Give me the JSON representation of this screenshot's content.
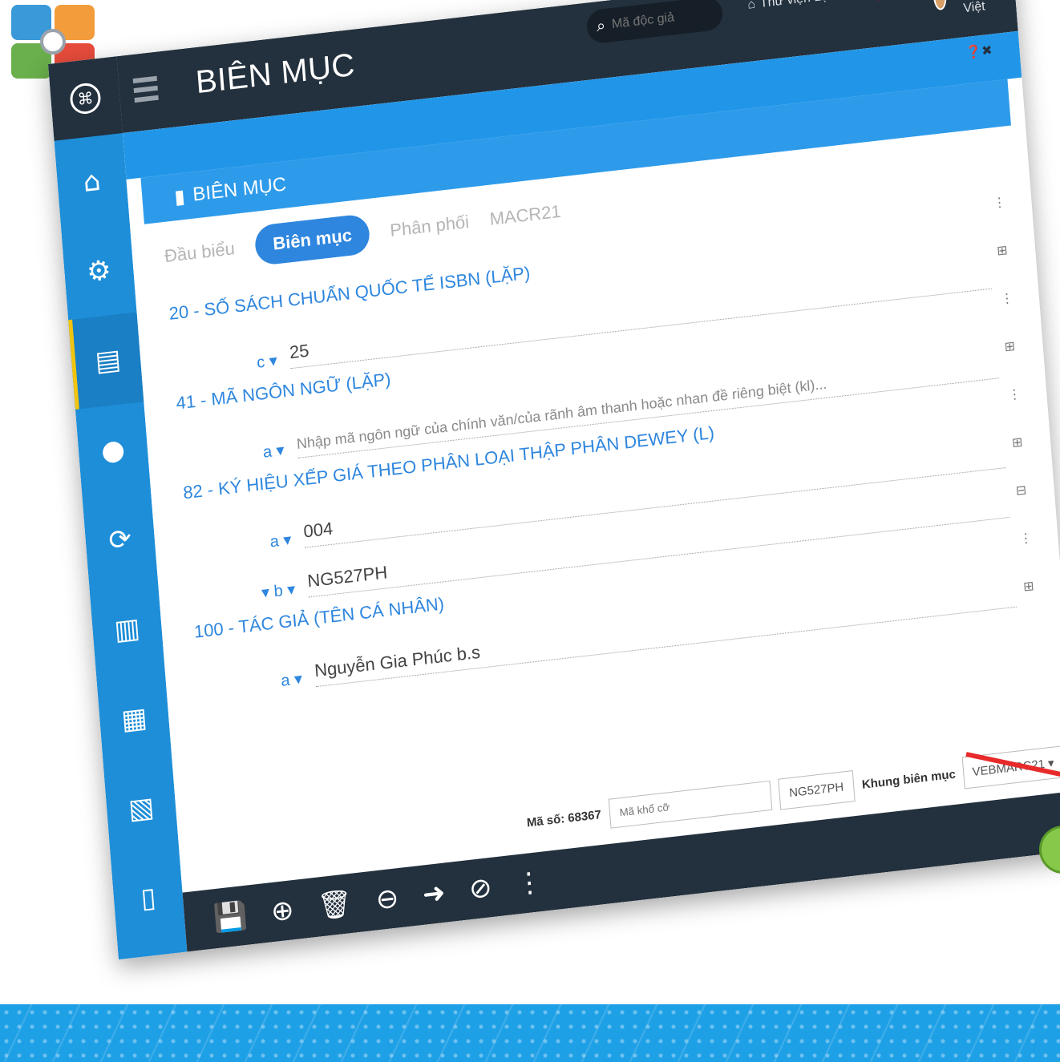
{
  "app": {
    "page_title": "BIÊN MỤC",
    "panel_title": "BIÊN MỤC"
  },
  "topbar": {
    "search_placeholder": "Mã độc giả",
    "library": "Thư viện Lạc V...",
    "user": "Quản trị viên Lạc Việt",
    "language_flag": "★"
  },
  "tabs": [
    "Đầu biểu",
    "Biên mục",
    "Phân phối",
    "MACR21"
  ],
  "fields": [
    {
      "title": "20 - SỐ SÁCH CHUẨN QUỐC TẾ ISBN (LẶP)",
      "rows": [
        {
          "code": "c",
          "value": "25",
          "placeholder": false
        }
      ]
    },
    {
      "title": "41 - MÃ NGÔN NGỮ (LẶP)",
      "rows": [
        {
          "code": "a",
          "value": "Nhập mã ngôn ngữ của chính văn/của rãnh âm thanh hoặc nhan đề riêng biệt (kl)...",
          "placeholder": true
        }
      ]
    },
    {
      "title": "82 - KÝ HIỆU XẾP GIÁ THEO PHÂN LOẠI THẬP PHÂN DEWEY (L)",
      "rows": [
        {
          "code": "a",
          "value": "004",
          "placeholder": false
        },
        {
          "code": "b",
          "value": "NG527PH",
          "placeholder": false
        }
      ]
    },
    {
      "title": "100 - TÁC GIẢ (TÊN CÁ NHÂN)",
      "rows": [
        {
          "code": "a",
          "value": "Nguyễn Gia Phúc b.s",
          "placeholder": false
        }
      ]
    }
  ],
  "meta": {
    "ma_so": "Mã số: 68367",
    "ma_kho_co_placeholder": "Mã khổ cỡ",
    "call_number": "NG527PH",
    "khung_label": "Khung biên mục",
    "khung_value": "VEBMARC21"
  },
  "colors": {
    "sidebar": "#1e8ed8",
    "topbar": "#23303d",
    "accent": "#2e86de",
    "pointer": "#e82a2a"
  },
  "icons": {
    "sidebar": [
      "home-icon",
      "gear-icon",
      "book-icon",
      "user-icon",
      "refresh-icon",
      "chart-icon",
      "keyboard-icon",
      "calendar-icon",
      "file-icon",
      "copy-icon"
    ],
    "toolbar": [
      "save-icon",
      "zoom-in-icon",
      "trash-icon",
      "arrow-left-icon",
      "arrow-right-icon",
      "cancel-icon",
      "more-icon"
    ]
  }
}
